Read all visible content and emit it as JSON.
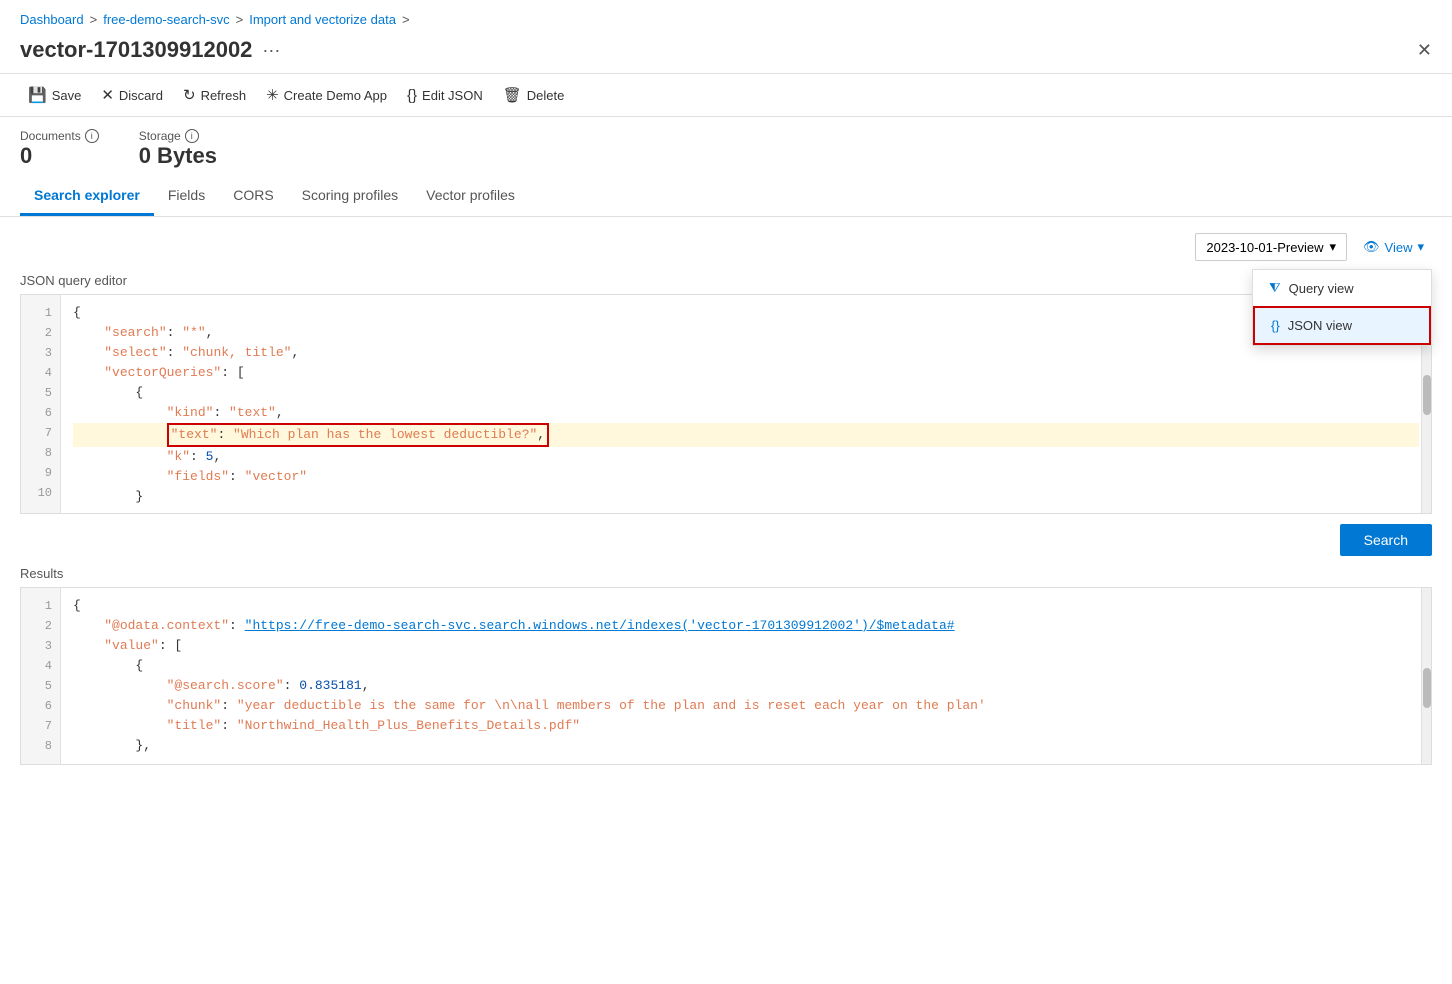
{
  "breadcrumb": {
    "items": [
      "Dashboard",
      "free-demo-search-svc",
      "Import and vectorize data"
    ]
  },
  "title": "vector-1701309912002",
  "title_more": "···",
  "toolbar": {
    "save": "Save",
    "discard": "Discard",
    "refresh": "Refresh",
    "create_demo_app": "Create Demo App",
    "edit_json": "Edit JSON",
    "delete": "Delete"
  },
  "stats": {
    "documents_label": "Documents",
    "documents_value": "0",
    "storage_label": "Storage",
    "storage_value": "0 Bytes"
  },
  "tabs": [
    {
      "label": "Search explorer",
      "active": true
    },
    {
      "label": "Fields",
      "active": false
    },
    {
      "label": "CORS",
      "active": false
    },
    {
      "label": "Scoring profiles",
      "active": false
    },
    {
      "label": "Vector profiles",
      "active": false
    }
  ],
  "api_version": "2023-10-01-Preview",
  "view_label": "View",
  "view_options": [
    {
      "label": "Query view",
      "icon": "filter"
    },
    {
      "label": "JSON view",
      "icon": "braces",
      "selected": true
    }
  ],
  "editor_label": "JSON query editor",
  "code_lines": [
    {
      "num": 1,
      "content": "{"
    },
    {
      "num": 2,
      "content": "    \"search\": \"*\","
    },
    {
      "num": 3,
      "content": "    \"select\": \"chunk, title\","
    },
    {
      "num": 4,
      "content": "    \"vectorQueries\": ["
    },
    {
      "num": 5,
      "content": "        {"
    },
    {
      "num": 6,
      "content": "            \"kind\": \"text\","
    },
    {
      "num": 7,
      "content": "            \"text\": \"Which plan has the lowest deductible?\",",
      "highlight": true
    },
    {
      "num": 8,
      "content": "            \"k\": 5,"
    },
    {
      "num": 9,
      "content": "            \"fields\": \"vector\""
    },
    {
      "num": 10,
      "content": "        }"
    }
  ],
  "search_button": "Search",
  "results_label": "Results",
  "result_lines": [
    {
      "num": 1,
      "content": "{"
    },
    {
      "num": 2,
      "content": "    \"@odata.context\": \"https://free-demo-search-svc.search.windows.net/indexes('vector-1701309912002')/$metadata#",
      "is_url": true
    },
    {
      "num": 3,
      "content": "    \"value\": ["
    },
    {
      "num": 4,
      "content": "        {"
    },
    {
      "num": 5,
      "content": "            \"@search.score\": 0.835181,"
    },
    {
      "num": 6,
      "content": "            \"chunk\": \"year deductible is the same for \\n\\nall members of the plan and is reset each year on the plan'"
    },
    {
      "num": 7,
      "content": "            \"title\": \"Northwind_Health_Plus_Benefits_Details.pdf\""
    },
    {
      "num": 8,
      "content": "        },"
    }
  ]
}
